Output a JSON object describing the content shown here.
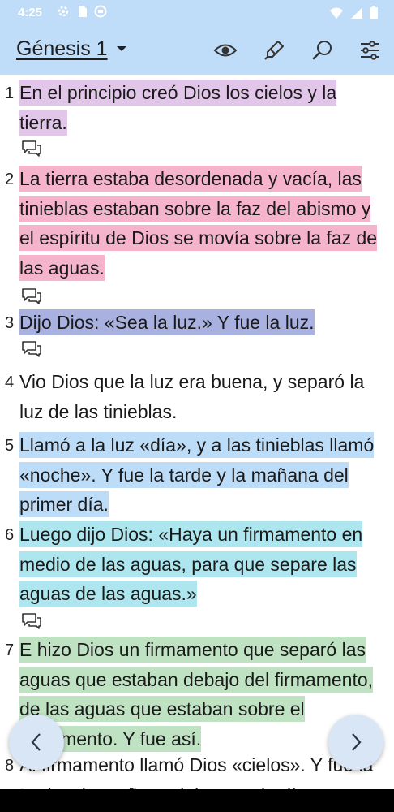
{
  "status_bar": {
    "time": "4:25",
    "left_icons": [
      "settings-gear-icon",
      "sim-card-icon",
      "notification-circle-icon"
    ],
    "right_icons": [
      "wifi-icon",
      "cellular-signal-icon",
      "battery-icon"
    ]
  },
  "app_bar": {
    "title": "Génesis 1",
    "actions": [
      "eye-icon",
      "highlighter-pen-icon",
      "search-icon",
      "tune-sliders-icon"
    ]
  },
  "verses": [
    {
      "number": "1",
      "text": "En el principio creó Dios los cielos y la tierra.",
      "highlight": "#e2c6ea",
      "has_note": true
    },
    {
      "number": "2",
      "text": "La tierra estaba desordenada y vacía, las tinieblas estaban sobre la faz del abismo y el espíritu de Dios se movía sobre la faz de las aguas.",
      "highlight": "#f6b4cc",
      "has_note": true
    },
    {
      "number": "3",
      "text": "Dijo Dios: «Sea la luz.» Y fue la luz.",
      "highlight": "#a9b1e0",
      "has_note": true
    },
    {
      "number": "4",
      "text": "Vio Dios que la luz era buena, y separó la luz de las tinieblas.",
      "highlight": "none",
      "has_note": false
    },
    {
      "number": "5",
      "text": "Llamó a la luz «día», y a las tinieblas llamó «noche». Y fue la tarde y la mañana del primer día.",
      "highlight": "#bcdcf8",
      "has_note": false
    },
    {
      "number": "6",
      "text": "Luego dijo Dios: «Haya un firmamento en medio de las aguas, para que separe las aguas de las aguas.»",
      "highlight": "#ade6ee",
      "has_note": true
    },
    {
      "number": "7",
      "text": "E hizo Dios un firmamento que separó las aguas que estaban debajo del firmamento, de las aguas que estaban sobre el firmamento. Y fue así.",
      "highlight": "#bfe2c2",
      "has_note": false
    },
    {
      "number": "8",
      "text": "Al firmamento llamó Dios «cielos». Y fue la tarde y la mañana del segundo día.",
      "highlight": "none",
      "has_note": false
    }
  ],
  "navigation": {
    "prev_icon": "chevron-left-icon",
    "next_icon": "chevron-right-icon"
  },
  "colors": {
    "app_bar": "#bfdcf8",
    "fab": "#d9e6f6"
  }
}
